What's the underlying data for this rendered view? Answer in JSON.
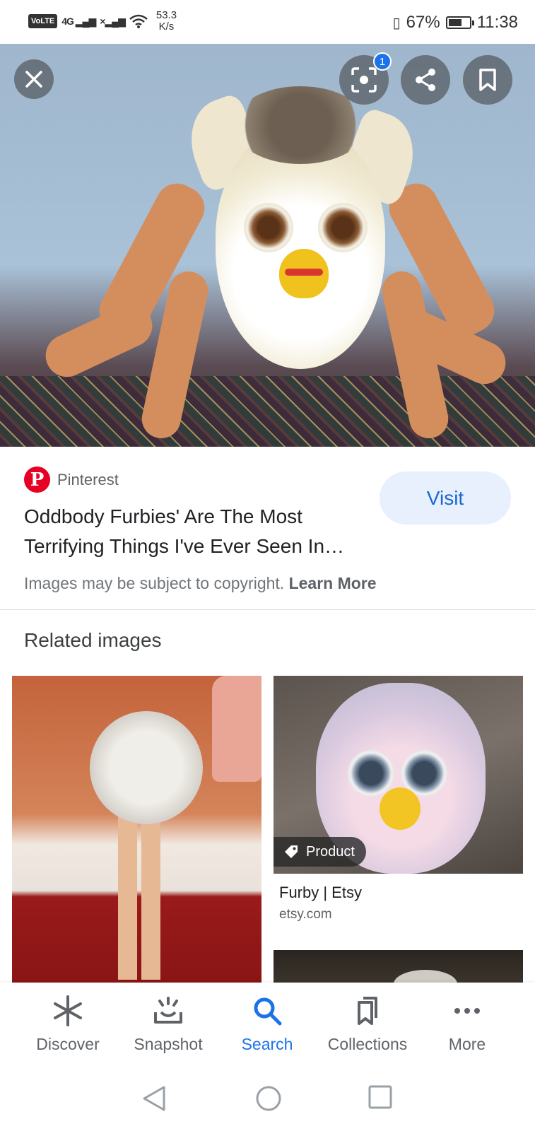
{
  "status_bar": {
    "volte": "VoLTE",
    "network": "4G",
    "speed_value": "53.3",
    "speed_unit": "K/s",
    "battery_percent": "67%",
    "battery_level": 0.67,
    "time": "11:38"
  },
  "hero": {
    "lens_badge_count": "1",
    "icons": {
      "close": "close-icon",
      "lens": "lens-icon",
      "share": "share-icon",
      "save": "bookmark-icon"
    }
  },
  "result": {
    "source": "Pinterest",
    "title": "Oddbody Furbies' Are The Most Terrifying Things I've Ever Seen In…",
    "visit_label": "Visit",
    "copyright_text": "Images may be subject to copyright.",
    "learn_more": "Learn More"
  },
  "related": {
    "heading": "Related images",
    "items": [
      {
        "title": "",
        "source": ""
      },
      {
        "chip": "Product",
        "title": "Furby | Etsy",
        "source": "etsy.com"
      },
      {
        "title": "",
        "source": ""
      }
    ]
  },
  "bottom_nav": {
    "items": [
      {
        "label": "Discover",
        "icon": "asterisk-icon"
      },
      {
        "label": "Snapshot",
        "icon": "snapshot-icon"
      },
      {
        "label": "Search",
        "icon": "search-icon"
      },
      {
        "label": "Collections",
        "icon": "collections-icon"
      },
      {
        "label": "More",
        "icon": "more-icon"
      }
    ],
    "active": "Search",
    "active_color": "#1a73e8"
  },
  "system_nav": {
    "icons": [
      "back-icon",
      "home-icon",
      "recents-icon"
    ]
  }
}
